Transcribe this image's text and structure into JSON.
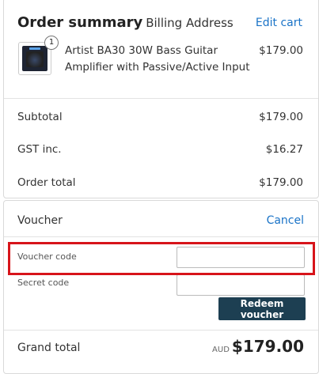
{
  "summary": {
    "title": "Order summary",
    "subtitle": "Billing Address",
    "edit_cart": "Edit cart"
  },
  "item": {
    "name": "Artist BA30 30W Bass Guitar Amplifier with Passive/Active Input",
    "price": "$179.00",
    "qty": "1",
    "image": "amplifier-thumbnail"
  },
  "totals": {
    "subtotal_label": "Subtotal",
    "subtotal_value": "$179.00",
    "gst_label": "GST inc.",
    "gst_value": "$16.27",
    "order_total_label": "Order total",
    "order_total_value": "$179.00"
  },
  "voucher": {
    "title": "Voucher",
    "cancel": "Cancel",
    "code_label": "Voucher code",
    "code_value": "",
    "secret_label": "Secret code",
    "secret_value": "",
    "redeem": "Redeem voucher"
  },
  "grand_total": {
    "label": "Grand total",
    "currency": "AUD",
    "amount": "$179.00"
  },
  "colors": {
    "link": "#1a73c7",
    "button": "#1d3f52",
    "highlight": "#d7141a"
  }
}
